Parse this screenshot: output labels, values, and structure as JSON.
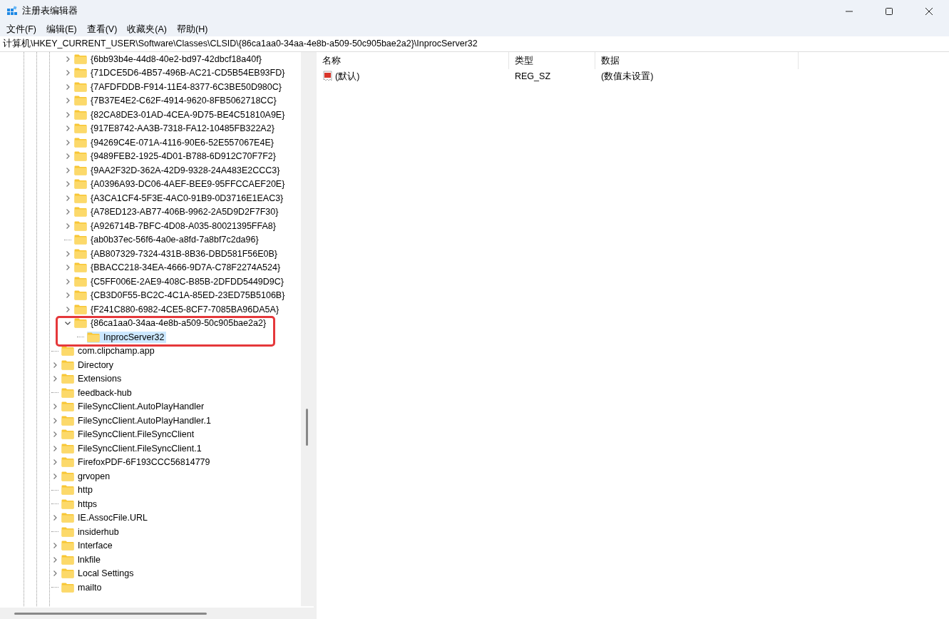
{
  "window": {
    "title": "注册表编辑器"
  },
  "menu": [
    "文件(F)",
    "编辑(E)",
    "查看(V)",
    "收藏夹(A)",
    "帮助(H)"
  ],
  "address": "计算机\\HKEY_CURRENT_USER\\Software\\Classes\\CLSID\\{86ca1aa0-34aa-4e8b-a509-50c905bae2a2}\\InprocServer32",
  "tree": {
    "nested_items": [
      {
        "label": "{6bb93b4e-44d8-40e2-bd97-42dbcf18a40f}",
        "expandable": true,
        "expanded": false,
        "selected": false
      },
      {
        "label": "{71DCE5D6-4B57-496B-AC21-CD5B54EB93FD}",
        "expandable": true,
        "expanded": false,
        "selected": false
      },
      {
        "label": "{7AFDFDDB-F914-11E4-8377-6C3BE50D980C}",
        "expandable": true,
        "expanded": false,
        "selected": false
      },
      {
        "label": "{7B37E4E2-C62F-4914-9620-8FB5062718CC}",
        "expandable": true,
        "expanded": false,
        "selected": false
      },
      {
        "label": "{82CA8DE3-01AD-4CEA-9D75-BE4C51810A9E}",
        "expandable": true,
        "expanded": false,
        "selected": false
      },
      {
        "label": "{917E8742-AA3B-7318-FA12-10485FB322A2}",
        "expandable": true,
        "expanded": false,
        "selected": false
      },
      {
        "label": "{94269C4E-071A-4116-90E6-52E557067E4E}",
        "expandable": true,
        "expanded": false,
        "selected": false
      },
      {
        "label": "{9489FEB2-1925-4D01-B788-6D912C70F7F2}",
        "expandable": true,
        "expanded": false,
        "selected": false
      },
      {
        "label": "{9AA2F32D-362A-42D9-9328-24A483E2CCC3}",
        "expandable": true,
        "expanded": false,
        "selected": false
      },
      {
        "label": "{A0396A93-DC06-4AEF-BEE9-95FFCCAEF20E}",
        "expandable": true,
        "expanded": false,
        "selected": false
      },
      {
        "label": "{A3CA1CF4-5F3E-4AC0-91B9-0D3716E1EAC3}",
        "expandable": true,
        "expanded": false,
        "selected": false
      },
      {
        "label": "{A78ED123-AB77-406B-9962-2A5D9D2F7F30}",
        "expandable": true,
        "expanded": false,
        "selected": false
      },
      {
        "label": "{A926714B-7BFC-4D08-A035-80021395FFA8}",
        "expandable": true,
        "expanded": false,
        "selected": false
      },
      {
        "label": "{ab0b37ec-56f6-4a0e-a8fd-7a8bf7c2da96}",
        "expandable": false,
        "selected": false
      },
      {
        "label": "{AB807329-7324-431B-8B36-DBD581F56E0B}",
        "expandable": true,
        "expanded": false,
        "selected": false
      },
      {
        "label": "{BBACC218-34EA-4666-9D7A-C78F2274A524}",
        "expandable": true,
        "expanded": false,
        "selected": false
      },
      {
        "label": "{C5FF006E-2AE9-408C-B85B-2DFDD5449D9C}",
        "expandable": true,
        "expanded": false,
        "selected": false
      },
      {
        "label": "{CB3D0F55-BC2C-4C1A-85ED-23ED75B5106B}",
        "expandable": true,
        "expanded": false,
        "selected": false
      },
      {
        "label": "{F241C880-6982-4CE5-8CF7-7085BA96DA5A}",
        "expandable": true,
        "expanded": false,
        "selected": false
      },
      {
        "label": "{86ca1aa0-34aa-4e8b-a509-50c905bae2a2}",
        "expandable": true,
        "expanded": true,
        "selected": false,
        "highlighted": true,
        "children": [
          {
            "label": "InprocServer32",
            "expandable": false,
            "selected": true
          }
        ]
      }
    ],
    "items": [
      {
        "label": "com.clipchamp.app",
        "expandable": false,
        "selected": false
      },
      {
        "label": "Directory",
        "expandable": true,
        "expanded": false,
        "selected": false
      },
      {
        "label": "Extensions",
        "expandable": true,
        "expanded": false,
        "selected": false
      },
      {
        "label": "feedback-hub",
        "expandable": false,
        "selected": false
      },
      {
        "label": "FileSyncClient.AutoPlayHandler",
        "expandable": true,
        "expanded": false,
        "selected": false
      },
      {
        "label": "FileSyncClient.AutoPlayHandler.1",
        "expandable": true,
        "expanded": false,
        "selected": false
      },
      {
        "label": "FileSyncClient.FileSyncClient",
        "expandable": true,
        "expanded": false,
        "selected": false
      },
      {
        "label": "FileSyncClient.FileSyncClient.1",
        "expandable": true,
        "expanded": false,
        "selected": false
      },
      {
        "label": "FirefoxPDF-6F193CCC56814779",
        "expandable": true,
        "expanded": false,
        "selected": false
      },
      {
        "label": "grvopen",
        "expandable": true,
        "expanded": false,
        "selected": false
      },
      {
        "label": "http",
        "expandable": false,
        "selected": false
      },
      {
        "label": "https",
        "expandable": false,
        "selected": false
      },
      {
        "label": "IE.AssocFile.URL",
        "expandable": true,
        "expanded": false,
        "selected": false
      },
      {
        "label": "insiderhub",
        "expandable": false,
        "selected": false
      },
      {
        "label": "Interface",
        "expandable": true,
        "expanded": false,
        "selected": false
      },
      {
        "label": "lnkfile",
        "expandable": true,
        "expanded": false,
        "selected": false
      },
      {
        "label": "Local Settings",
        "expandable": true,
        "expanded": false,
        "selected": false
      },
      {
        "label": "mailto",
        "expandable": false,
        "selected": false
      }
    ]
  },
  "values": {
    "columns": [
      "名称",
      "类型",
      "数据"
    ],
    "rows": [
      {
        "name": "(默认)",
        "type": "REG_SZ",
        "data": "(数值未设置)"
      }
    ]
  }
}
